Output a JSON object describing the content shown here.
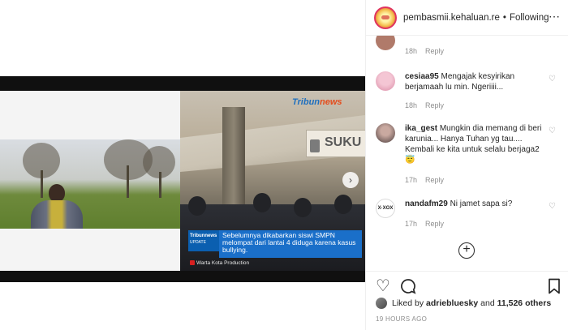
{
  "post": {
    "username": "pembasmii.kehaluan.re",
    "separator": "•",
    "follow_label": "Following",
    "more_icon": "more-icon"
  },
  "video": {
    "left_watermark": "",
    "brand_logo_text": "Tribun",
    "brand_logo_suffix": "news",
    "sign_text": "SUKU",
    "caption_badge_brand": "Tribunnews",
    "caption_badge_label": "UPDATE",
    "caption_text": "Sebelumnya dikabarkan siswi SMPN melompat dari lantai 4 diduga karena kasus bullying.",
    "credit": "Warta Kota Production"
  },
  "comments": [
    {
      "username": "",
      "text": "",
      "time": "18h",
      "reply_label": "Reply",
      "avatar_color": "#b07a6a"
    },
    {
      "username": "cesiaa95",
      "text": "Mengajak kesyirikan berjamaah lu min. Ngeriiii...",
      "time": "18h",
      "reply_label": "Reply",
      "avatar_color": "#e8a0b8"
    },
    {
      "username": "ika_gest",
      "text": "Mungkin dia memang di beri karunia... Hanya Tuhan yg tau.... Kembali ke kita untuk selalu berjaga2 😇",
      "time": "17h",
      "reply_label": "Reply",
      "avatar_color": "#6a5a5a"
    },
    {
      "username": "nandafm29",
      "text": "Ni jamet sapa si?",
      "time": "17h",
      "reply_label": "Reply",
      "avatar_color": "#ffffff"
    }
  ],
  "load_more_icon": "plus-circle-icon",
  "likes": {
    "prefix": "Liked by",
    "user": "adriebluesky",
    "connector": "and",
    "others": "11,526 others"
  },
  "timestamp": "19 HOURS AGO"
}
